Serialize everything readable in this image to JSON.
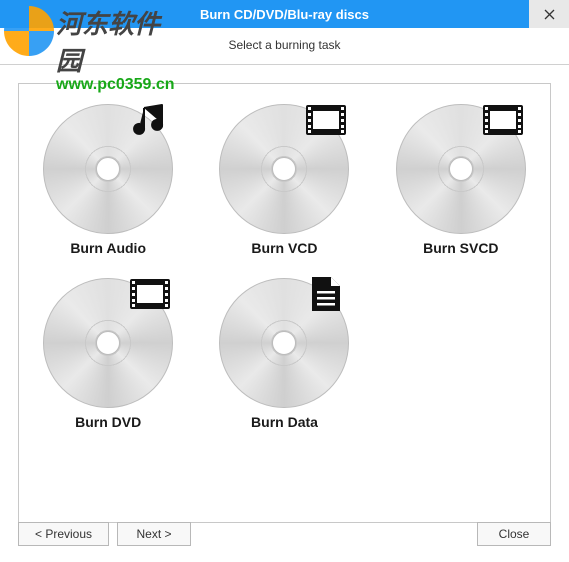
{
  "window": {
    "title": "Burn CD/DVD/Blu-ray discs",
    "subtitle": "Select a burning task"
  },
  "tiles": [
    {
      "label": "Burn Audio",
      "icon": "music"
    },
    {
      "label": "Burn VCD",
      "icon": "film"
    },
    {
      "label": "Burn SVCD",
      "icon": "film"
    },
    {
      "label": "Burn DVD",
      "icon": "film"
    },
    {
      "label": "Burn Data",
      "icon": "doc"
    }
  ],
  "buttons": {
    "previous": "< Previous",
    "next": "Next >",
    "close": "Close"
  },
  "watermark": {
    "line1": "河东软件园",
    "line2": "www.pc0359.cn"
  }
}
